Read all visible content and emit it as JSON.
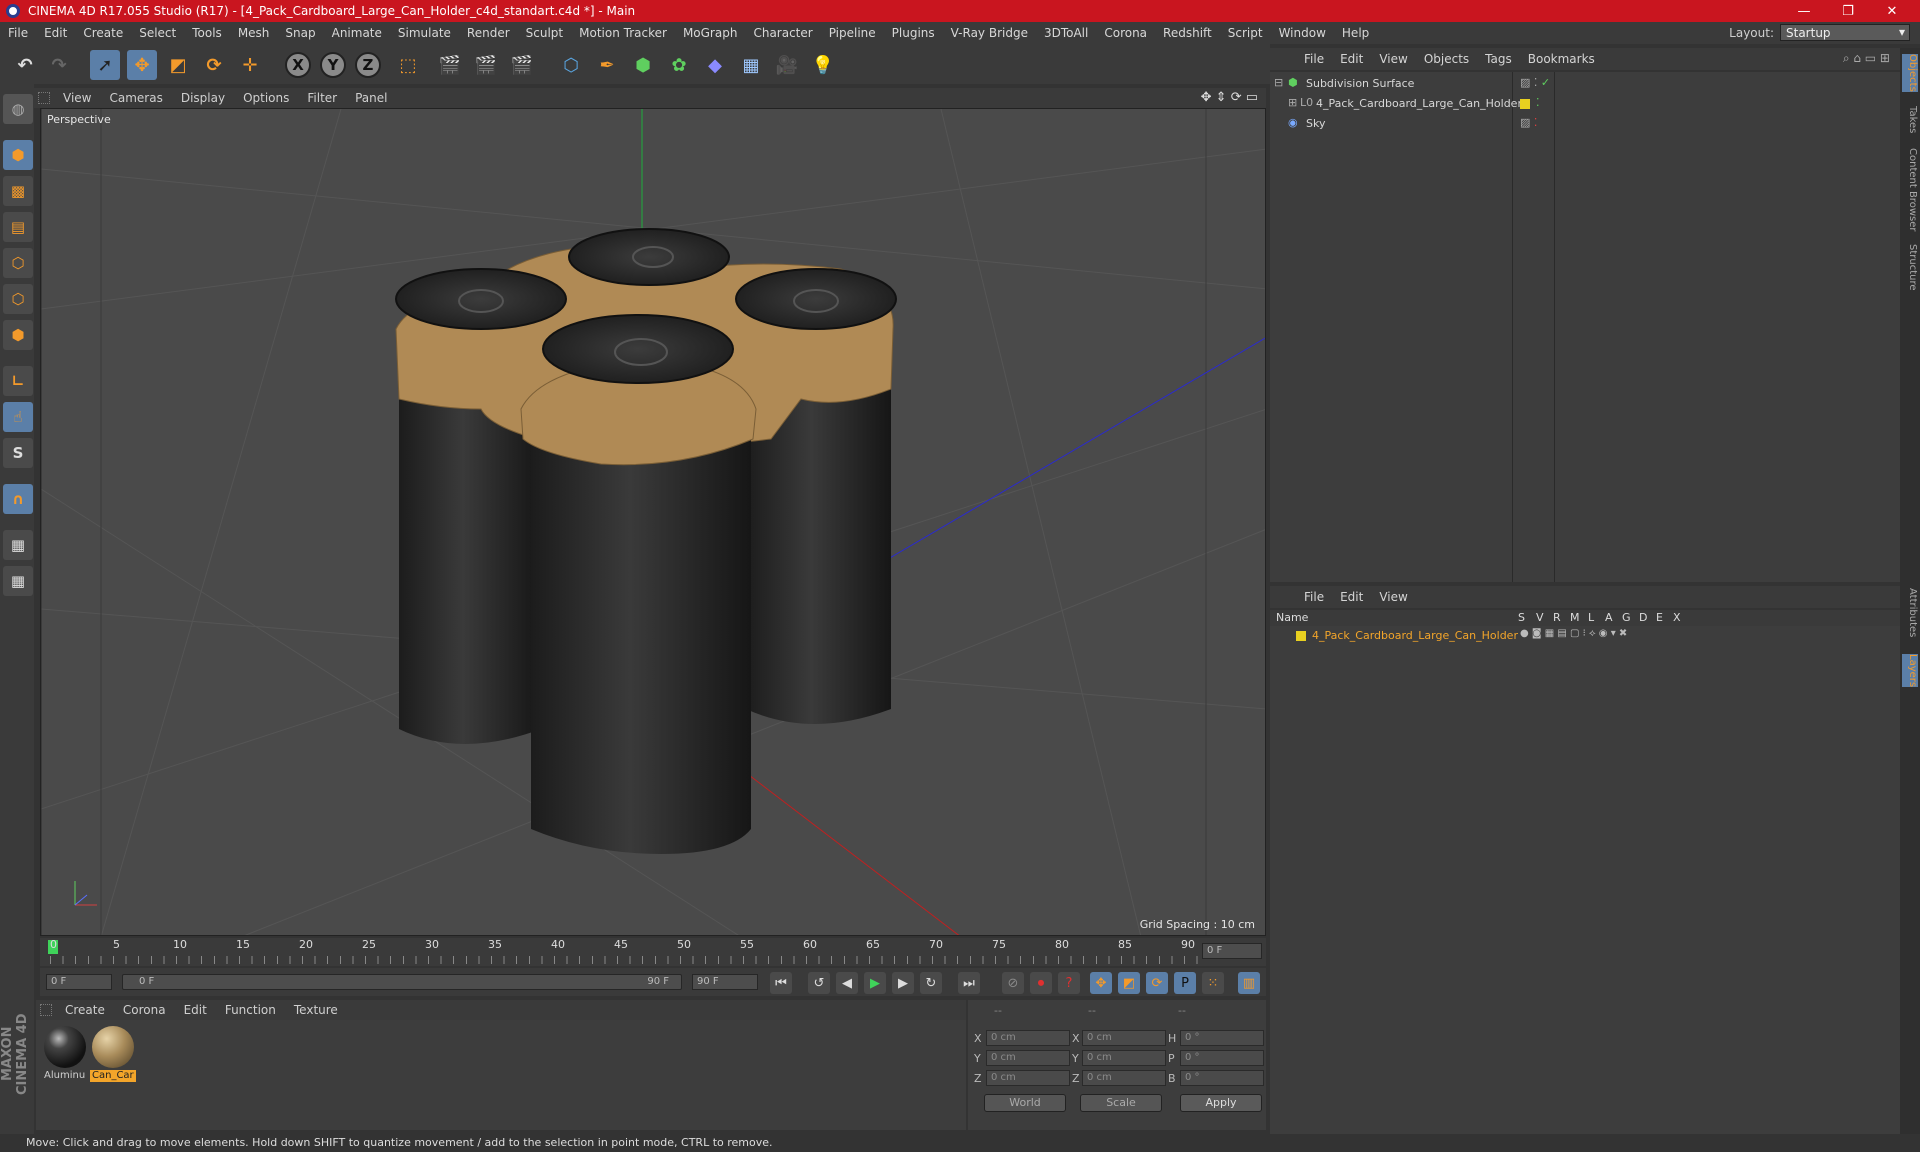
{
  "window": {
    "title": "CINEMA 4D R17.055 Studio (R17) - [4_Pack_Cardboard_Large_Can_Holder_c4d_standart.c4d *] - Main",
    "minimize": "—",
    "maximize": "❐",
    "close": "✕"
  },
  "menu": [
    "File",
    "Edit",
    "Create",
    "Select",
    "Tools",
    "Mesh",
    "Snap",
    "Animate",
    "Simulate",
    "Render",
    "Sculpt",
    "Motion Tracker",
    "MoGraph",
    "Character",
    "Pipeline",
    "Plugins",
    "V-Ray Bridge",
    "3DToAll",
    "Corona",
    "Redshift",
    "Script",
    "Window",
    "Help"
  ],
  "layout": {
    "label": "Layout:",
    "value": "Startup"
  },
  "viewport": {
    "menu": [
      "View",
      "Cameras",
      "Display",
      "Options",
      "Filter",
      "Panel"
    ],
    "label": "Perspective",
    "grid_spacing": "Grid Spacing : 10 cm"
  },
  "timeline": {
    "ticks": [
      "0",
      "5",
      "10",
      "15",
      "20",
      "25",
      "30",
      "35",
      "40",
      "45",
      "50",
      "55",
      "60",
      "65",
      "70",
      "75",
      "80",
      "85",
      "90"
    ],
    "current_frame": "0 F",
    "start_field": "0 F",
    "range_start": "0 F",
    "range_end": "90 F",
    "end_field": "90 F"
  },
  "materials": {
    "menu": [
      "Create",
      "Corona",
      "Edit",
      "Function",
      "Texture"
    ],
    "items": [
      {
        "label": "Aluminu",
        "selected": false
      },
      {
        "label": "Can_Car",
        "selected": true
      }
    ]
  },
  "coordinates": {
    "head": [
      "--",
      "--",
      "--"
    ],
    "rows": [
      {
        "a": "X",
        "v1": "0 cm",
        "b": "X",
        "v2": "0 cm",
        "c": "H",
        "v3": "0 °"
      },
      {
        "a": "Y",
        "v1": "0 cm",
        "b": "Y",
        "v2": "0 cm",
        "c": "P",
        "v3": "0 °"
      },
      {
        "a": "Z",
        "v1": "0 cm",
        "b": "Z",
        "v2": "0 cm",
        "c": "B",
        "v3": "0 °"
      }
    ],
    "mode": "World",
    "scale": "Scale",
    "apply": "Apply"
  },
  "objects": {
    "menu": [
      "File",
      "Edit",
      "View",
      "Objects",
      "Tags",
      "Bookmarks"
    ],
    "items": [
      {
        "name": "Subdivision Surface",
        "color": "#dddddd"
      },
      {
        "name": "4_Pack_Cardboard_Large_Can_Holder",
        "color": "#dddddd"
      },
      {
        "name": "Sky",
        "color": "#dddddd"
      }
    ]
  },
  "layers": {
    "menu": [
      "File",
      "Edit",
      "View"
    ],
    "head": "Name",
    "cols": [
      "S",
      "V",
      "R",
      "M",
      "L",
      "A",
      "G",
      "D",
      "E",
      "X"
    ],
    "items": [
      {
        "name": "4_Pack_Cardboard_Large_Can_Holder",
        "color": "#e0b020"
      }
    ]
  },
  "side_tabs": [
    "Objects",
    "Takes",
    "Content Browser",
    "Structure",
    "Attributes",
    "Layers"
  ],
  "status": "Move: Click and drag to move elements. Hold down SHIFT to quantize movement / add to the selection in point mode, CTRL to remove.",
  "brand": "MAXON CINEMA 4D",
  "colors": {
    "title_bar": "#c9151f",
    "accent": "#5b7fa8",
    "selected_text": "#f3a52a"
  }
}
